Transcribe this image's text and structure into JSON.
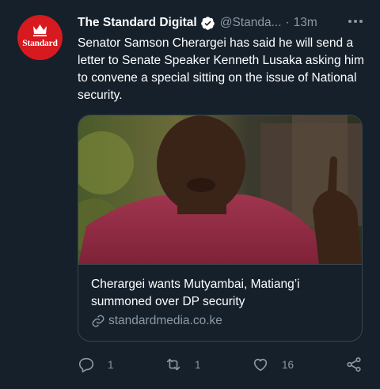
{
  "tweet": {
    "avatar_label": "Standard",
    "display_name": "The Standard Digital",
    "handle": "@Standa...",
    "separator": "·",
    "time": "13m",
    "text": "Senator Samson Cherargei has said he will send a letter to Senate Speaker Kenneth Lusaka asking him to convene a special sitting on the issue of National security.",
    "card": {
      "title": "Cherargei wants Mutyambai, Matiang’i summoned over DP security",
      "domain": "standardmedia.co.ke"
    },
    "actions": {
      "replies": "1",
      "retweets": "1",
      "likes": "16"
    }
  },
  "colors": {
    "background": "#15202b",
    "secondary_text": "#8b98a5",
    "border": "#38444d",
    "brand_red": "#d71920"
  },
  "icons": [
    "verified-badge-icon",
    "more-icon",
    "link-icon",
    "reply-icon",
    "retweet-icon",
    "like-icon",
    "share-icon"
  ]
}
